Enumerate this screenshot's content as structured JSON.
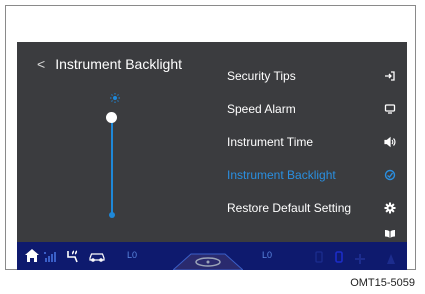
{
  "header": {
    "back_glyph": "<",
    "title": "Instrument Backlight"
  },
  "slider": {
    "icon": "brightness-sun-icon",
    "level": 1.0
  },
  "menu": [
    {
      "label": "Security Tips",
      "icon": "exit-icon",
      "active": false
    },
    {
      "label": "Speed Alarm",
      "icon": "display-icon",
      "active": false
    },
    {
      "label": "Instrument Time",
      "icon": "speaker-icon",
      "active": false
    },
    {
      "label": "Instrument Backlight",
      "icon": "brightness-icon",
      "active": true
    },
    {
      "label": "Restore Default Setting",
      "icon": "gear-icon",
      "active": false
    },
    {
      "label": "",
      "icon": "book-icon",
      "active": false
    }
  ],
  "statusbar": {
    "left_level": "L0",
    "right_level": "L0",
    "icons": [
      "home-icon",
      "signal-icon",
      "seat-heat-icon",
      "car-icon",
      "steering-icon",
      "battery-icon",
      "fan-icon"
    ]
  },
  "caption": "OMT15-5059",
  "colors": {
    "screen_bg": "#3b3c3f",
    "accent": "#2a8fe0",
    "statusbar_bg": "#0e1a6e"
  }
}
